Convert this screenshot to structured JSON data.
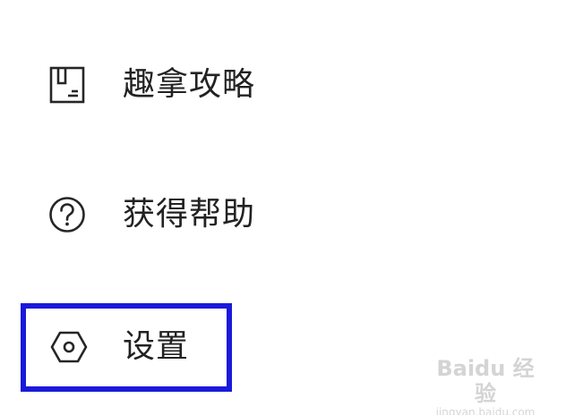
{
  "menu": {
    "items": [
      {
        "label": "趣拿攻略",
        "icon": "guide-document-icon"
      },
      {
        "label": "获得帮助",
        "icon": "help-question-icon"
      },
      {
        "label": "设置",
        "icon": "settings-hexagon-icon"
      }
    ]
  },
  "highlight": {
    "target": "settings",
    "color": "#1a1adb"
  },
  "watermark": {
    "brand": "Baidu 经验",
    "url": "jingyan.baidu.com"
  },
  "colors": {
    "text": "#222222",
    "icon_stroke": "#262626",
    "background": "#ffffff"
  }
}
